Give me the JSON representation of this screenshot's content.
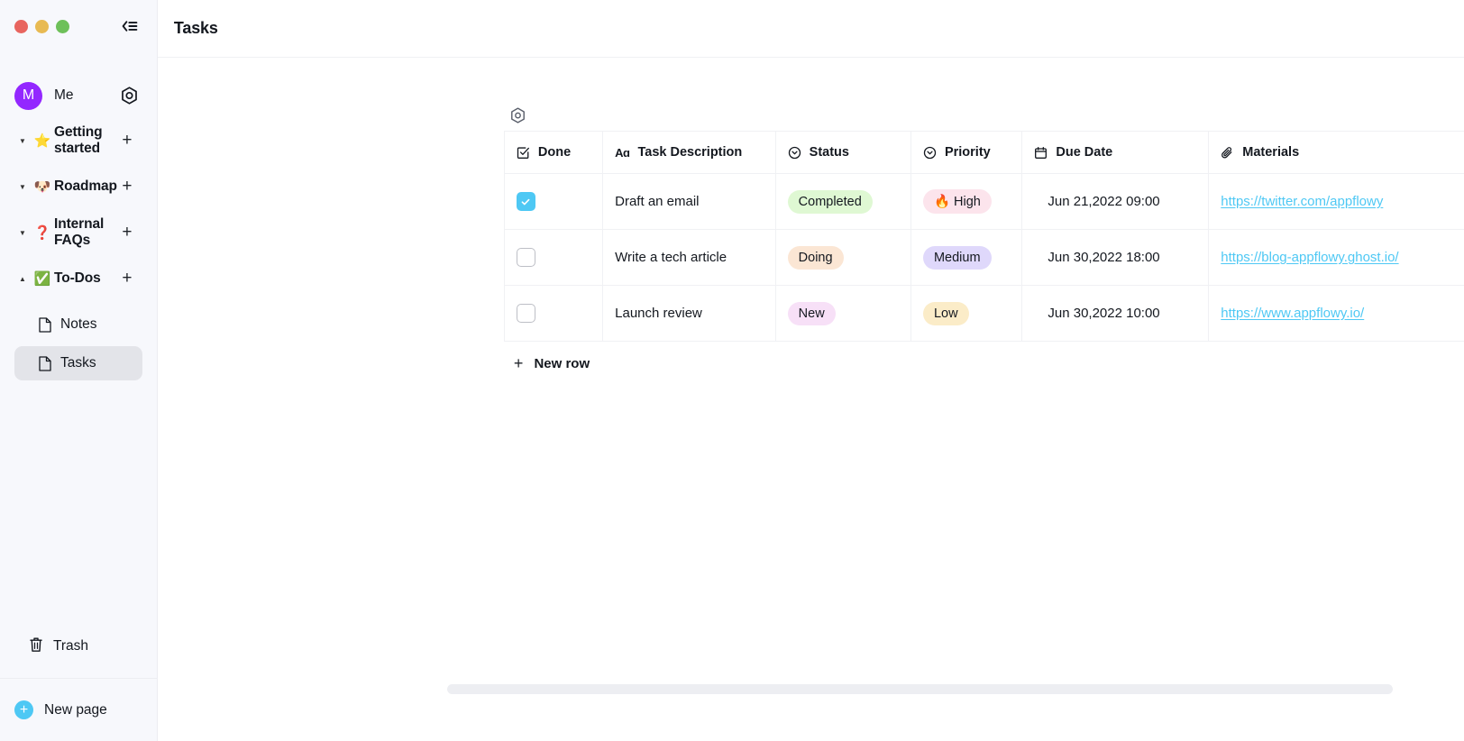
{
  "window": {
    "traffic_lights": [
      "close",
      "minimize",
      "maximize"
    ],
    "collapse_tooltip": "Collapse sidebar"
  },
  "sidebar": {
    "user": {
      "initial": "M",
      "name": "Me",
      "avatar_color": "#9327FF"
    },
    "settings_label": "Settings",
    "tree": [
      {
        "emoji": "⭐",
        "label": "Getting started",
        "expanded": true,
        "children": []
      },
      {
        "emoji": "🐶",
        "label": "Roadmap",
        "expanded": true,
        "children": []
      },
      {
        "emoji": "❓",
        "label": "Internal FAQs",
        "expanded": true,
        "children": []
      },
      {
        "emoji": "✅",
        "label": "To-Dos",
        "expanded": true,
        "children": [
          {
            "label": "Notes",
            "selected": false
          },
          {
            "label": "Tasks",
            "selected": true
          }
        ]
      }
    ],
    "trash_label": "Trash",
    "new_page_label": "New page"
  },
  "header": {
    "title": "Tasks"
  },
  "grid": {
    "settings_button_label": "Grid settings",
    "add_column_label": "+",
    "new_row_label": "New row",
    "columns": [
      {
        "key": "done",
        "label": "Done",
        "icon": "checkbox-icon"
      },
      {
        "key": "desc",
        "label": "Task Description",
        "icon": "text-aa-icon"
      },
      {
        "key": "status",
        "label": "Status",
        "icon": "single-select-icon"
      },
      {
        "key": "priority",
        "label": "Priority",
        "icon": "single-select-icon"
      },
      {
        "key": "date",
        "label": "Due Date",
        "icon": "calendar-icon"
      },
      {
        "key": "materials",
        "label": "Materials",
        "icon": "paperclip-icon"
      }
    ],
    "rows": [
      {
        "done": true,
        "desc": "Draft an email",
        "status": {
          "text": "Completed",
          "bg": "#DFF8D3",
          "fg": "#14181F"
        },
        "priority": {
          "text": "🔥 High",
          "bg": "#FCE4EC",
          "fg": "#14181F"
        },
        "date": "Jun 21,2022  09:00",
        "materials": "https://twitter.com/appflowy"
      },
      {
        "done": false,
        "desc": "Write a tech article",
        "status": {
          "text": "Doing",
          "bg": "#FBE6D4",
          "fg": "#14181F"
        },
        "priority": {
          "text": "Medium",
          "bg": "#DFD8FB",
          "fg": "#14181F"
        },
        "date": "Jun 30,2022  18:00",
        "materials": "https://blog-appflowy.ghost.io/"
      },
      {
        "done": false,
        "desc": "Launch review",
        "status": {
          "text": "New",
          "bg": "#F7E0F7",
          "fg": "#14181F"
        },
        "priority": {
          "text": "Low",
          "bg": "#FBECC8",
          "fg": "#14181F"
        },
        "date": "Jun 30,2022  10:00",
        "materials": "https://www.appflowy.io/"
      }
    ]
  },
  "footer": {
    "help_label": "?"
  },
  "colors": {
    "accent": "#4EC8F4",
    "sidebar_bg": "#F7F8FC",
    "link": "#4EC8F4",
    "selected_row": "#E3E4E9"
  }
}
